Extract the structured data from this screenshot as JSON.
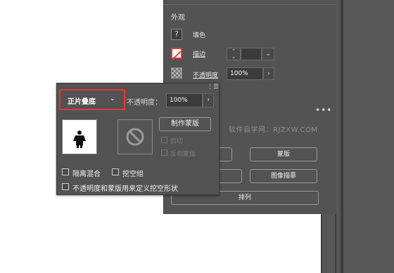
{
  "properties_panel": {
    "section_title": "外观",
    "fill_label": "填色",
    "stroke_label": "描边",
    "opacity_label": "不透明度",
    "opacity_value": "100%",
    "buttons": {
      "mask": "蒙版",
      "image_trace": "图像描摹",
      "arrange": "排列"
    },
    "more": "•••"
  },
  "watermark": "软件自学网：RJZXW.COM",
  "transparency_popup": {
    "blend_mode": "正片叠底",
    "opacity_label": "不透明度：",
    "opacity_value": "100%",
    "make_mask_button": "制作蒙版",
    "clip_label": "剪切",
    "invert_mask_label": "反相蒙版",
    "isolate_blending_label": "隔离混合",
    "knockout_group_label": "挖空组",
    "opacity_mask_knockout_label": "不透明度和蒙版用来定义挖空形状"
  },
  "colors": {
    "panel_bg": "#535353",
    "highlight_red": "#e53935"
  },
  "icons": {
    "help": "question-mark",
    "stroke": "no-stroke-swatch",
    "opacity": "checkerboard",
    "mask_placeholder": "prohibited-circle",
    "menu": "hamburger"
  }
}
